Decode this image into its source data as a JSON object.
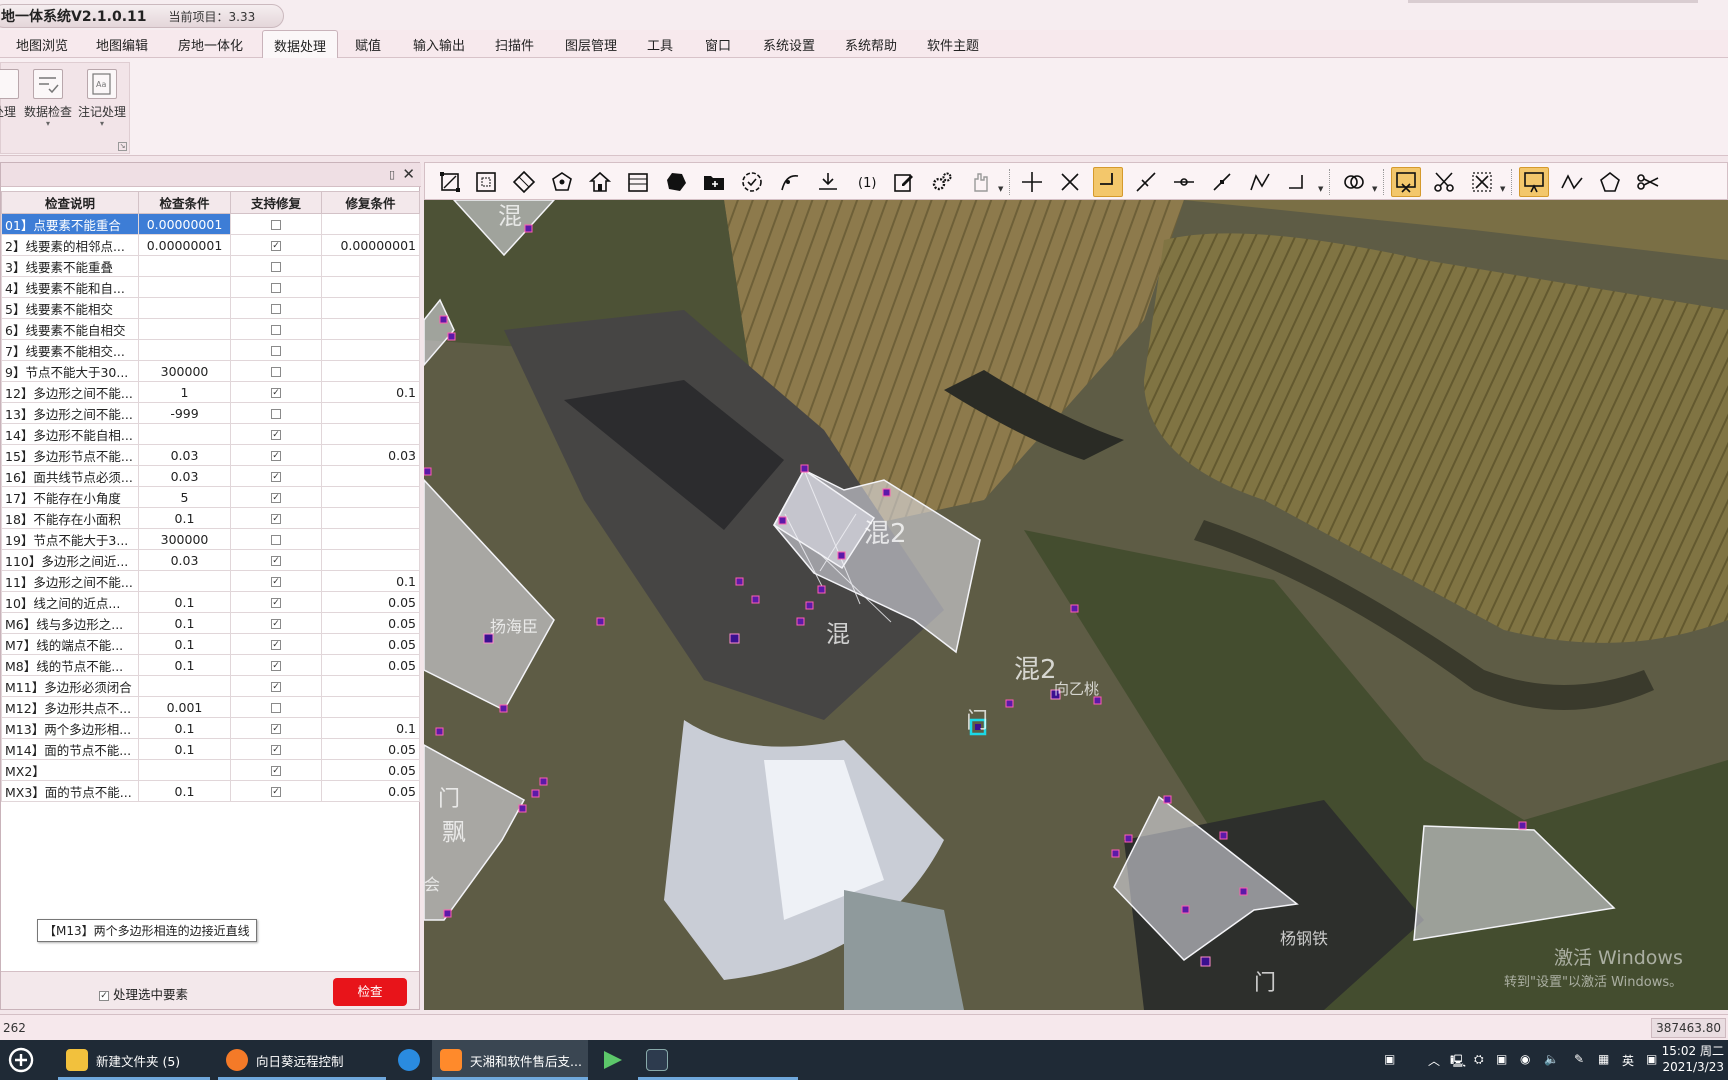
{
  "window": {
    "title": "地一体系统V2.1.0.11",
    "current_project": "当前项目：3.33"
  },
  "menu": {
    "tabs": [
      {
        "label": "地图浏览"
      },
      {
        "label": "地图编辑"
      },
      {
        "label": "房地一体化"
      },
      {
        "label": "数据处理"
      },
      {
        "label": "赋值"
      },
      {
        "label": "输入输出"
      },
      {
        "label": "扫描件"
      },
      {
        "label": "图层管理"
      },
      {
        "label": "工具"
      },
      {
        "label": "窗口"
      },
      {
        "label": "系统设置"
      },
      {
        "label": "系统帮助"
      },
      {
        "label": "软件主题"
      }
    ],
    "active": "数据处理"
  },
  "ribbon": {
    "b0": "处理",
    "b1": "数据检查",
    "b2": "注记处理"
  },
  "panel": {
    "columns": {
      "desc": "检查说明",
      "cond": "检查条件",
      "fix_support": "支持修复",
      "fix_cond": "修复条件"
    },
    "rows": [
      {
        "desc": "01】点要素不能重合",
        "cond": "0.00000001",
        "check": "□",
        "fix": ""
      },
      {
        "desc": "2】线要素的相邻点...",
        "cond": "0.00000001",
        "check": "☑",
        "fix": "0.00000001"
      },
      {
        "desc": "3】线要素不能重叠",
        "cond": "",
        "check": "□",
        "fix": ""
      },
      {
        "desc": "4】线要素不能和自...",
        "cond": "",
        "check": "□",
        "fix": ""
      },
      {
        "desc": "5】线要素不能相交",
        "cond": "",
        "check": "□",
        "fix": ""
      },
      {
        "desc": "6】线要素不能自相交",
        "cond": "",
        "check": "□",
        "fix": ""
      },
      {
        "desc": "7】线要素不能相交...",
        "cond": "",
        "check": "□",
        "fix": ""
      },
      {
        "desc": "9】节点不能大于30...",
        "cond": "300000",
        "check": "□",
        "fix": ""
      },
      {
        "desc": "12】多边形之间不能...",
        "cond": "1",
        "check": "☑",
        "fix": "0.1"
      },
      {
        "desc": "13】多边形之间不能...",
        "cond": "-999",
        "check": "□",
        "fix": ""
      },
      {
        "desc": "14】多边形不能自相...",
        "cond": "",
        "check": "☑",
        "fix": ""
      },
      {
        "desc": "15】多边形节点不能...",
        "cond": "0.03",
        "check": "☑",
        "fix": "0.03"
      },
      {
        "desc": "16】面共线节点必须...",
        "cond": "0.03",
        "check": "☑",
        "fix": ""
      },
      {
        "desc": "17】不能存在小角度",
        "cond": "5",
        "check": "☑",
        "fix": ""
      },
      {
        "desc": "18】不能存在小面积",
        "cond": "0.1",
        "check": "☑",
        "fix": ""
      },
      {
        "desc": "19】节点不能大于3...",
        "cond": "300000",
        "check": "□",
        "fix": ""
      },
      {
        "desc": "110】多边形之间近...",
        "cond": "0.03",
        "check": "☑",
        "fix": ""
      },
      {
        "desc": "11】多边形之间不能...",
        "cond": "",
        "check": "☑",
        "fix": "0.1"
      },
      {
        "desc": "10】线之间的近点...",
        "cond": "0.1",
        "check": "☑",
        "fix": "0.05"
      },
      {
        "desc": "M6】线与多边形之...",
        "cond": "0.1",
        "check": "☑",
        "fix": "0.05"
      },
      {
        "desc": "M7】线的端点不能...",
        "cond": "0.1",
        "check": "☑",
        "fix": "0.05"
      },
      {
        "desc": "M8】线的节点不能...",
        "cond": "0.1",
        "check": "☑",
        "fix": "0.05"
      },
      {
        "desc": "M11】多边形必须闭合",
        "cond": "",
        "check": "☑",
        "fix": ""
      },
      {
        "desc": "M12】多边形共点不...",
        "cond": "0.001",
        "check": "□",
        "fix": ""
      },
      {
        "desc": "M13】两个多边形相...",
        "cond": "0.1",
        "check": "☑",
        "fix": "0.1"
      },
      {
        "desc": "M14】面的节点不能...",
        "cond": "0.1",
        "check": "☑",
        "fix": "0.05"
      },
      {
        "desc": "MX2】",
        "cond": "",
        "check": "☑",
        "fix": "0.05"
      },
      {
        "desc": "MX3】面的节点不能...",
        "cond": "0.1",
        "check": "☑",
        "fix": "0.05"
      }
    ],
    "tooltip": "【M13】两个多边形相连的边接近直线",
    "process_selected_label": "处理选中要素",
    "check_button": "检查"
  },
  "map": {
    "labels": [
      "混",
      "混2",
      "混",
      "混2",
      "向乙桃",
      "门",
      "扬海臣",
      "门",
      "飘",
      "会",
      "杨钢铁",
      "门"
    ],
    "watermark": [
      "激活 Windows",
      "转到\"设置\"以激活 Windows。"
    ]
  },
  "status": {
    "left": "262",
    "coords": "387463.80"
  },
  "taskbar": {
    "apps": [
      "新建文件夹 (5)",
      "向日葵远程控制",
      "天湘和软件售后支..."
    ],
    "tray_lang": "英",
    "time": "15:02 周二",
    "date": "2021/3/23"
  },
  "colors": {
    "accent": "#e8141a",
    "selection": "#3d7dd6",
    "vertex": "#5b1aa8",
    "highlight": "#f3c76b"
  }
}
